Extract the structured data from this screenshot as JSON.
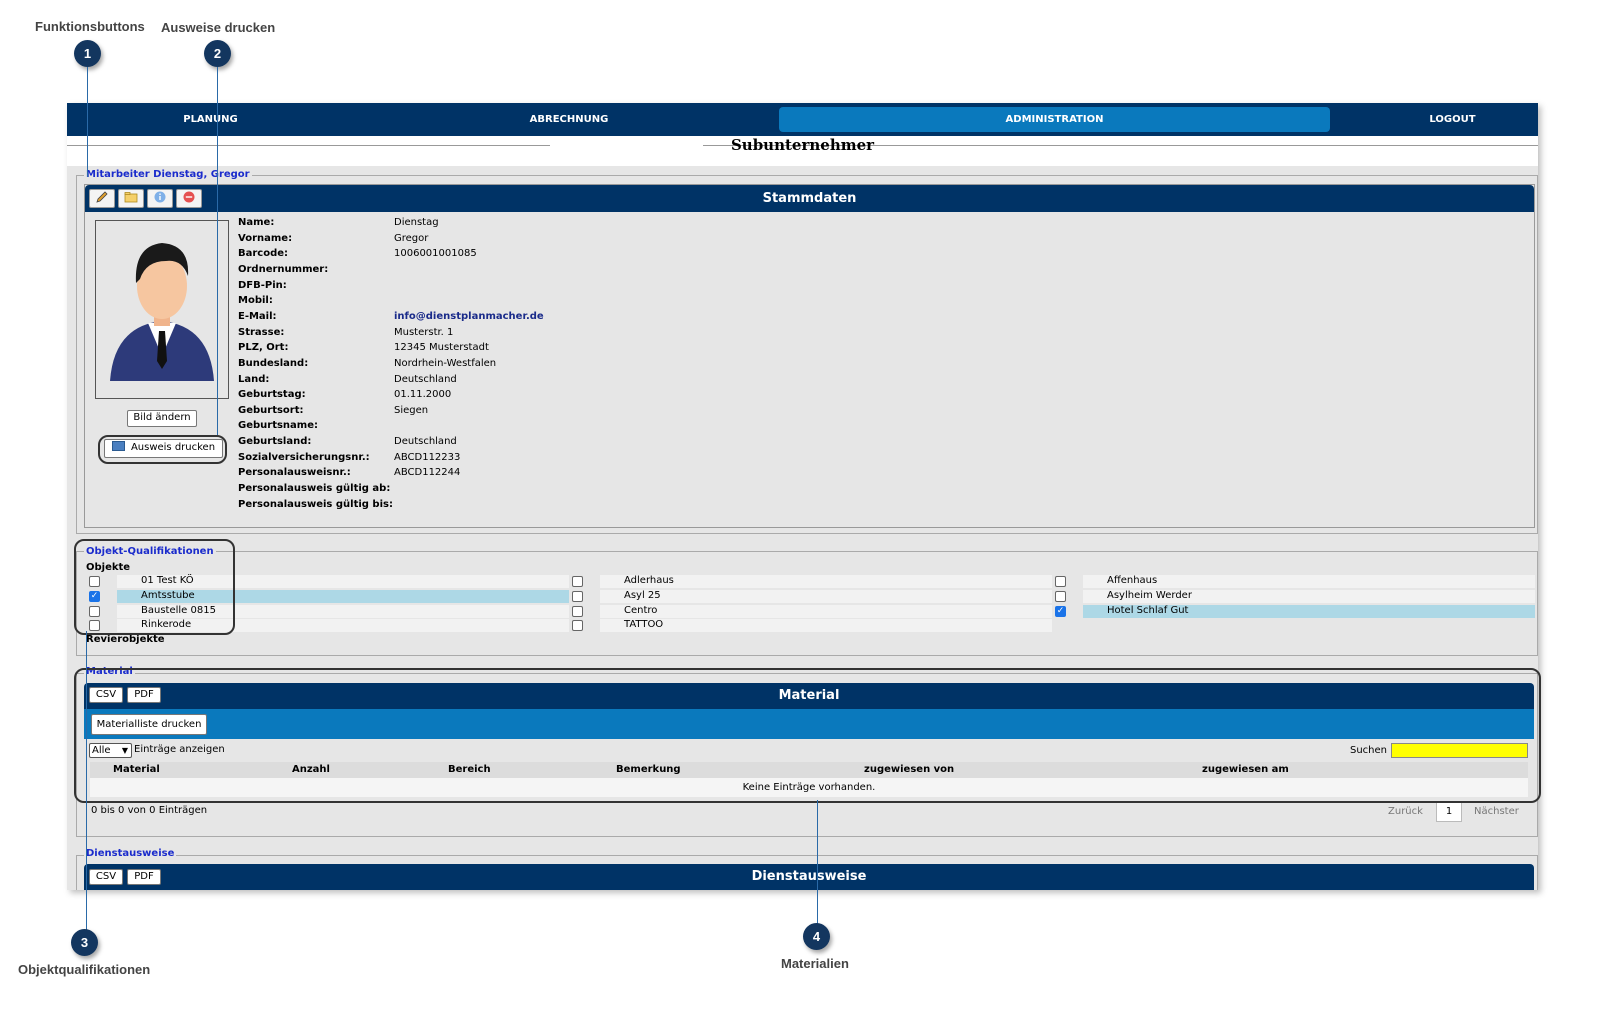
{
  "annotations": {
    "1": {
      "number": "1",
      "label": "Funktionsbuttons"
    },
    "2": {
      "number": "2",
      "label": "Ausweise drucken"
    },
    "3": {
      "number": "3",
      "label": "Objektqualifikationen"
    },
    "4": {
      "number": "4",
      "label": "Materialien"
    }
  },
  "nav": {
    "items": [
      {
        "label": "PLANUNG"
      },
      {
        "label": "ABRECHNUNG"
      },
      {
        "label": "ADMINISTRATION",
        "active": true
      },
      {
        "label": "LOGOUT"
      }
    ]
  },
  "page": {
    "title": "Subunternehmer"
  },
  "employee": {
    "legend": "Mitarbeiter Dienstag, Gregor",
    "header": "Stammdaten",
    "change_image_label": "Bild ändern",
    "print_id_label": "Ausweis drucken",
    "fields": [
      {
        "label": "Name:",
        "value": "Dienstag"
      },
      {
        "label": "Vorname:",
        "value": "Gregor"
      },
      {
        "label": "Barcode:",
        "value": "1006001001085"
      },
      {
        "label": "Ordnernummer:",
        "value": ""
      },
      {
        "label": "DFB-Pin:",
        "value": ""
      },
      {
        "label": "Mobil:",
        "value": ""
      },
      {
        "label": "E-Mail:",
        "value": "info@dienstplanmacher.de"
      },
      {
        "label": "Strasse:",
        "value": "Musterstr. 1"
      },
      {
        "label": "PLZ, Ort:",
        "value": "12345 Musterstadt"
      },
      {
        "label": "Bundesland:",
        "value": "Nordrhein-Westfalen"
      },
      {
        "label": "Land:",
        "value": "Deutschland"
      },
      {
        "label": "Geburtstag:",
        "value": "01.11.2000"
      },
      {
        "label": "Geburtsort:",
        "value": "Siegen"
      },
      {
        "label": "Geburtsname:",
        "value": ""
      },
      {
        "label": "Geburtsland:",
        "value": "Deutschland"
      },
      {
        "label": "Sozialversicherungsnr.:",
        "value": "ABCD112233"
      },
      {
        "label": "Personalausweisnr.:",
        "value": "ABCD112244"
      },
      {
        "label": "Personalausweis gültig ab:",
        "value": ""
      },
      {
        "label": "Personalausweis gültig bis:",
        "value": ""
      }
    ]
  },
  "qualifications": {
    "legend": "Objekt-Qualifikationen",
    "objects_heading": "Objekte",
    "district_heading": "Revierobjekte",
    "columns": [
      [
        {
          "name": "01 Test KÖ",
          "checked": false
        },
        {
          "name": "Amtsstube",
          "checked": true
        },
        {
          "name": "Baustelle 0815",
          "checked": false
        },
        {
          "name": "Rinkerode",
          "checked": false
        }
      ],
      [
        {
          "name": "Adlerhaus",
          "checked": false
        },
        {
          "name": "Asyl 25",
          "checked": false
        },
        {
          "name": "Centro",
          "checked": false
        },
        {
          "name": "TATTOO",
          "checked": false
        }
      ],
      [
        {
          "name": "Affenhaus",
          "checked": false
        },
        {
          "name": "Asylheim Werder",
          "checked": false
        },
        {
          "name": "Hotel Schlaf Gut",
          "checked": true
        }
      ]
    ]
  },
  "material": {
    "legend": "Material",
    "header": "Material",
    "csv_label": "CSV",
    "pdf_label": "PDF",
    "print_list_label": "Materialliste drucken",
    "page_size": "Alle",
    "show_entries_label": "Einträge anzeigen",
    "search_label": "Suchen",
    "search_value": "",
    "columns": [
      "Material",
      "Anzahl",
      "Bereich",
      "Bemerkung",
      "zugewiesen von",
      "zugewiesen am"
    ],
    "empty_text": "Keine Einträge vorhanden.",
    "info_text": "0 bis 0 von 0 Einträgen",
    "prev_label": "Zurück",
    "page_number": "1",
    "next_label": "Nächster",
    "search_highlight_color": "#ffff00"
  },
  "service_ids": {
    "legend": "Dienstausweise",
    "header": "Dienstausweise",
    "csv_label": "CSV",
    "pdf_label": "PDF"
  },
  "colors": {
    "nav": "#003366",
    "active": "#0a79bd",
    "selected_row": "#add8e6",
    "callout": "#13365f"
  }
}
